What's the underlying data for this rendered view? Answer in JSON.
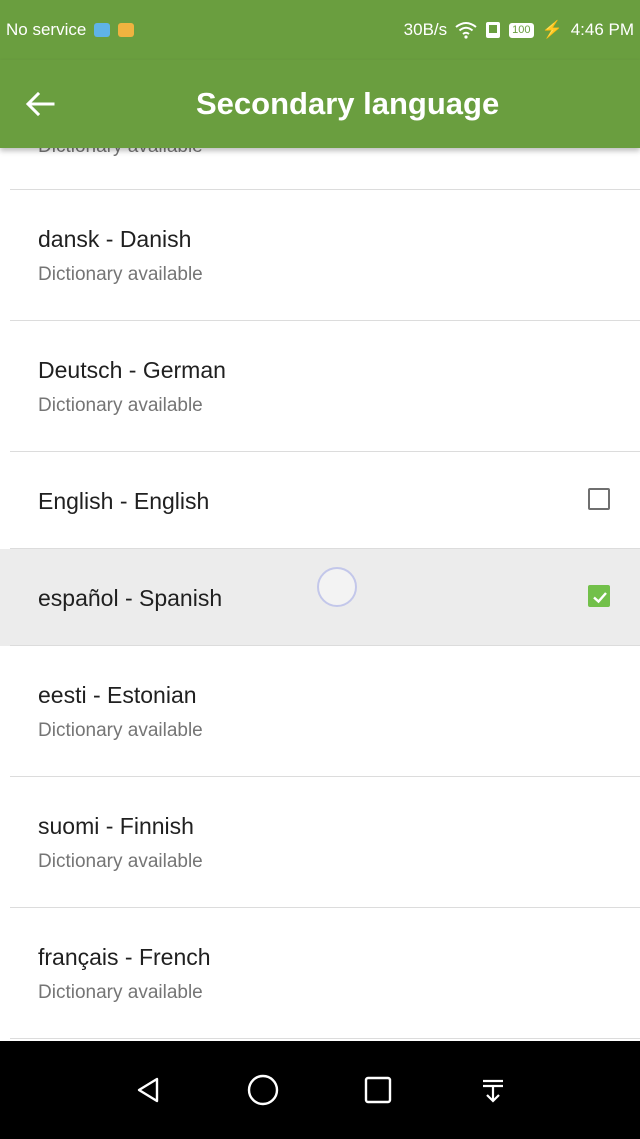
{
  "status_bar": {
    "left_text": "No service",
    "speed": "30B/s",
    "battery": "100",
    "time": "4:46 PM"
  },
  "app_bar": {
    "title": "Secondary language",
    "back_icon": "arrow-left-icon"
  },
  "list": {
    "partial_top_subtitle": "Dictionary available",
    "items": [
      {
        "name": "dansk - Danish",
        "subtitle": "Dictionary available"
      },
      {
        "name": "Deutsch - German",
        "subtitle": "Dictionary available"
      },
      {
        "name": "English - English",
        "checkbox": "unchecked"
      },
      {
        "name": "español - Spanish",
        "checkbox": "checked"
      },
      {
        "name": "eesti - Estonian",
        "subtitle": "Dictionary available"
      },
      {
        "name": "suomi - Finnish",
        "subtitle": "Dictionary available"
      },
      {
        "name": "français - French",
        "subtitle": "Dictionary available"
      }
    ]
  },
  "nav_bar": {
    "icons": [
      "back-triangle-icon",
      "home-circle-icon",
      "recents-square-icon",
      "notification-pull-icon"
    ]
  },
  "colors": {
    "primary": "#6a9e3f",
    "check_accent": "#72c04a",
    "selected_row": "#ececec"
  }
}
